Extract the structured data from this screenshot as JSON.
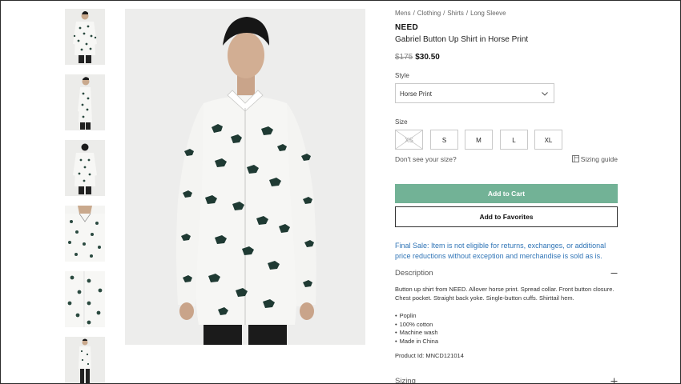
{
  "breadcrumb": [
    "Mens",
    "Clothing",
    "Shirts",
    "Long Sleeve"
  ],
  "product": {
    "brand": "NEED",
    "name": "Gabriel Button Up Shirt in Horse Print",
    "price_original": "$175",
    "price_sale": "$30.50"
  },
  "style": {
    "label": "Style",
    "selected": "Horse Print",
    "chevron_icon": "chevron-down-icon"
  },
  "size": {
    "label": "Size",
    "options": [
      {
        "label": "XS",
        "available": false
      },
      {
        "label": "S",
        "available": true
      },
      {
        "label": "M",
        "available": true
      },
      {
        "label": "L",
        "available": true
      },
      {
        "label": "XL",
        "available": true
      }
    ],
    "missing_text": "Don't see your size?",
    "guide_label": "Sizing guide",
    "guide_icon": "ruler-icon"
  },
  "buttons": {
    "add_to_cart": "Add to Cart",
    "add_to_favorites": "Add to Favorites"
  },
  "final_sale_note": "Final Sale: Item is not eligible for returns, exchanges, or additional price reductions without exception and merchandise is sold as is.",
  "description": {
    "heading": "Description",
    "toggle_icon": "minus-icon",
    "text": "Button up shirt from NEED. Allover horse print. Spread collar. Front button closure. Chest pocket. Straight back yoke. Single-button cuffs. Shirttail hem.",
    "bullets": [
      "Poplin",
      "100% cotton",
      "Machine wash",
      "Made in China"
    ],
    "product_id": "Product Id: MNCD121014"
  },
  "sizing": {
    "heading": "Sizing",
    "toggle_icon": "plus-icon"
  },
  "colors": {
    "accent_green": "#72b296",
    "link_blue": "#2f74b6",
    "print_dark": "#1f3a33"
  }
}
